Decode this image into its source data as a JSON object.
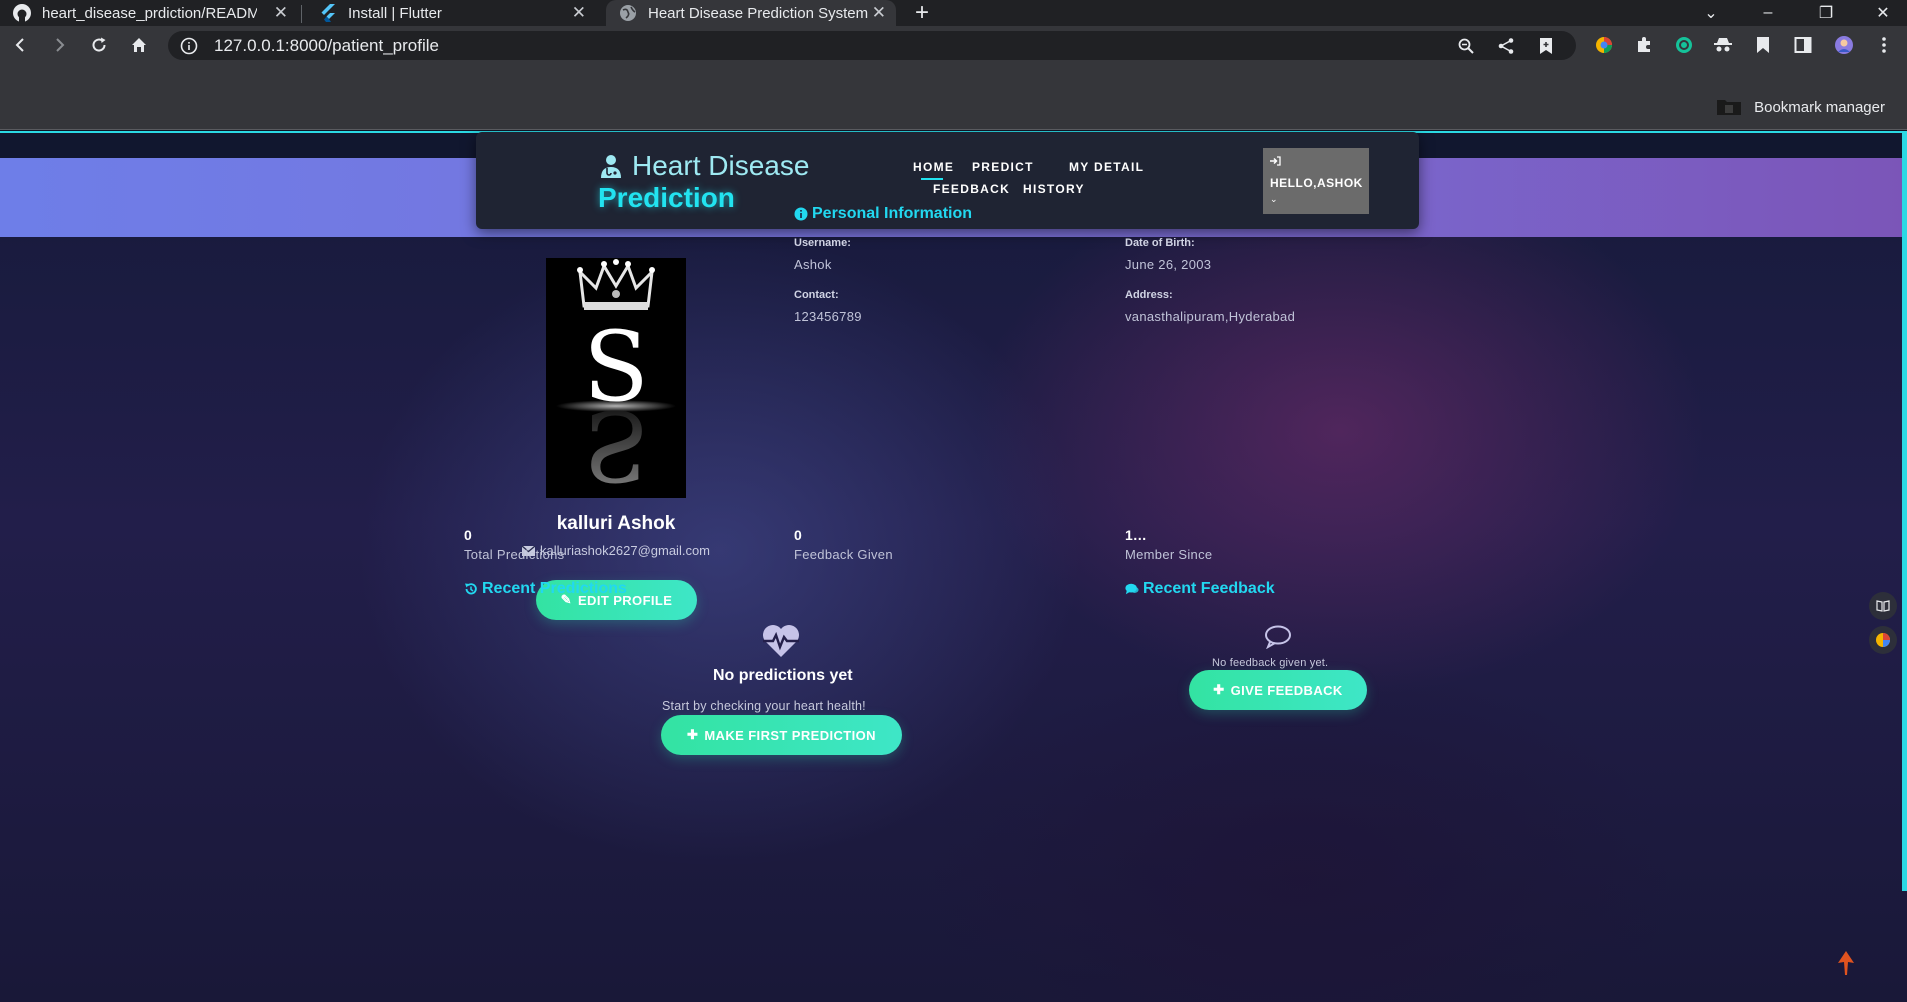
{
  "browser": {
    "tabs": [
      {
        "title": "heart_disease_prdiction/README.md",
        "icon": "github-icon"
      },
      {
        "title": "Install | Flutter",
        "icon": "flutter-icon"
      },
      {
        "title": "Heart Disease Prediction System",
        "icon": "globe-icon",
        "active": true
      }
    ],
    "url": "127.0.0.1:8000/patient_profile",
    "bookmark_manager": "Bookmark manager"
  },
  "nav": {
    "brand_line1": "Heart Disease",
    "brand_line2": "Prediction",
    "links": {
      "home": "HOME",
      "predict": "PREDICT",
      "my_detail": "MY DETAIL",
      "feedback": "FEEDBACK",
      "history": "HISTORY"
    },
    "greeting": "HELLO,ASHOK"
  },
  "profile": {
    "full_name": "kalluri Ashok",
    "email": "kalluriashok2627@gmail.com",
    "edit_button": "EDIT PROFILE",
    "avatar_letter": "S"
  },
  "personal_info": {
    "title": "Personal Information",
    "username_label": "Username:",
    "username": "Ashok",
    "dob_label": "Date of Birth:",
    "dob": "June 26, 2003",
    "contact_label": "Contact:",
    "contact": "123456789",
    "address_label": "Address:",
    "address": "vanasthalipuram,Hyderabad"
  },
  "stats": {
    "predictions_count": "0",
    "predictions_label": "Total Predictions",
    "feedback_count": "0",
    "feedback_label": "Feedback Given",
    "member_since": "1…",
    "member_label": "Member Since"
  },
  "recent_predictions": {
    "title": "Recent Predictions",
    "empty_title": "No predictions yet",
    "empty_sub": "Start by checking your heart health!",
    "button": "MAKE FIRST PREDICTION"
  },
  "recent_feedback": {
    "title": "Recent Feedback",
    "empty_sub": "No feedback given yet.",
    "button": "GIVE FEEDBACK"
  },
  "colors": {
    "accent": "#22e3f0",
    "button_green": "#33e3a2",
    "banner_left": "#6e7ee8",
    "banner_right": "#7b55b8"
  }
}
